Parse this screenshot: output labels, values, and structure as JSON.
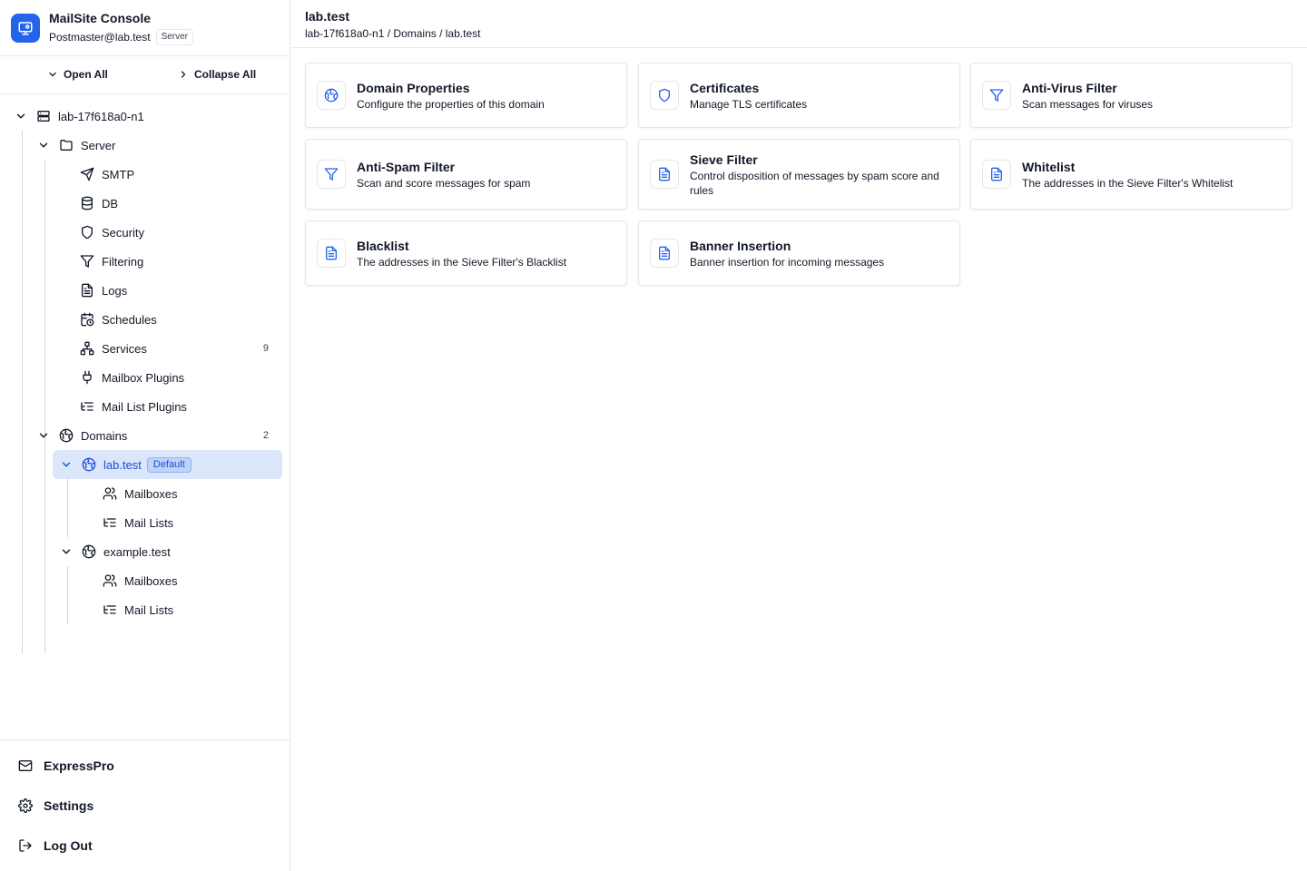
{
  "brand": {
    "title": "MailSite Console",
    "user": "Postmaster@lab.test",
    "role_badge": "Server",
    "logo_icon": "monitor-gear-icon"
  },
  "toolbar": {
    "open_all": "Open All",
    "collapse_all": "Collapse All"
  },
  "tree": {
    "root": "lab-17f618a0-n1",
    "server": "Server",
    "server_items": [
      "SMTP",
      "DB",
      "Security",
      "Filtering",
      "Logs",
      "Schedules",
      "Services",
      "Mailbox Plugins",
      "Mail List Plugins"
    ],
    "services_count": "9",
    "domains": "Domains",
    "domains_count": "2",
    "domain1": "lab.test",
    "domain1_badge": "Default",
    "domain1_items": [
      "Mailboxes",
      "Mail Lists"
    ],
    "domain2": "example.test",
    "domain2_items": [
      "Mailboxes",
      "Mail Lists"
    ]
  },
  "footer": {
    "expresspro": "ExpressPro",
    "settings": "Settings",
    "logout": "Log Out"
  },
  "header": {
    "title": "lab.test",
    "breadcrumb": "lab-17f618a0-n1 / Domains / lab.test"
  },
  "cards": [
    {
      "title": "Domain Properties",
      "desc": "Configure the properties of this domain",
      "icon": "globe-icon"
    },
    {
      "title": "Certificates",
      "desc": "Manage TLS certificates",
      "icon": "shield-icon"
    },
    {
      "title": "Anti-Virus Filter",
      "desc": "Scan messages for viruses",
      "icon": "filter-icon"
    },
    {
      "title": "Anti-Spam Filter",
      "desc": "Scan and score messages for spam",
      "icon": "filter-icon"
    },
    {
      "title": "Sieve Filter",
      "desc": "Control disposition of messages by spam score and rules",
      "icon": "document-icon"
    },
    {
      "title": "Whitelist",
      "desc": "The addresses in the Sieve Filter's Whitelist",
      "icon": "document-icon"
    },
    {
      "title": "Blacklist",
      "desc": "The addresses in the Sieve Filter's Blacklist",
      "icon": "document-icon"
    },
    {
      "title": "Banner Insertion",
      "desc": "Banner insertion for incoming messages",
      "icon": "document-icon"
    }
  ],
  "colors": {
    "accent": "#2563eb",
    "selected_bg": "#dbe6fb",
    "border": "#e5e7eb"
  }
}
